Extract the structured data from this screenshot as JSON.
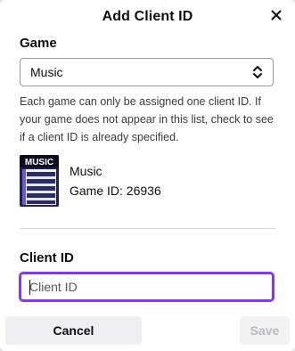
{
  "dialog": {
    "title": "Add Client ID",
    "close_icon": "close-icon"
  },
  "game_section": {
    "label": "Game",
    "selected_value": "Music",
    "select_icon": "chevron-up-down-icon",
    "help_text": "Each game can only be assigned one client ID. If your game does not appear in this list, check to see if a client ID is already specified."
  },
  "selected_game": {
    "art_label": "MUSIC",
    "name": "Music",
    "id_text": "Game ID: 26936"
  },
  "client_id_section": {
    "label": "Client ID",
    "placeholder": "Client ID",
    "value": ""
  },
  "footer": {
    "cancel_label": "Cancel",
    "save_label": "Save"
  },
  "colors": {
    "accent": "#8a33ff",
    "text": "#0e0e10",
    "disabled_text": "#b8b8bd"
  }
}
